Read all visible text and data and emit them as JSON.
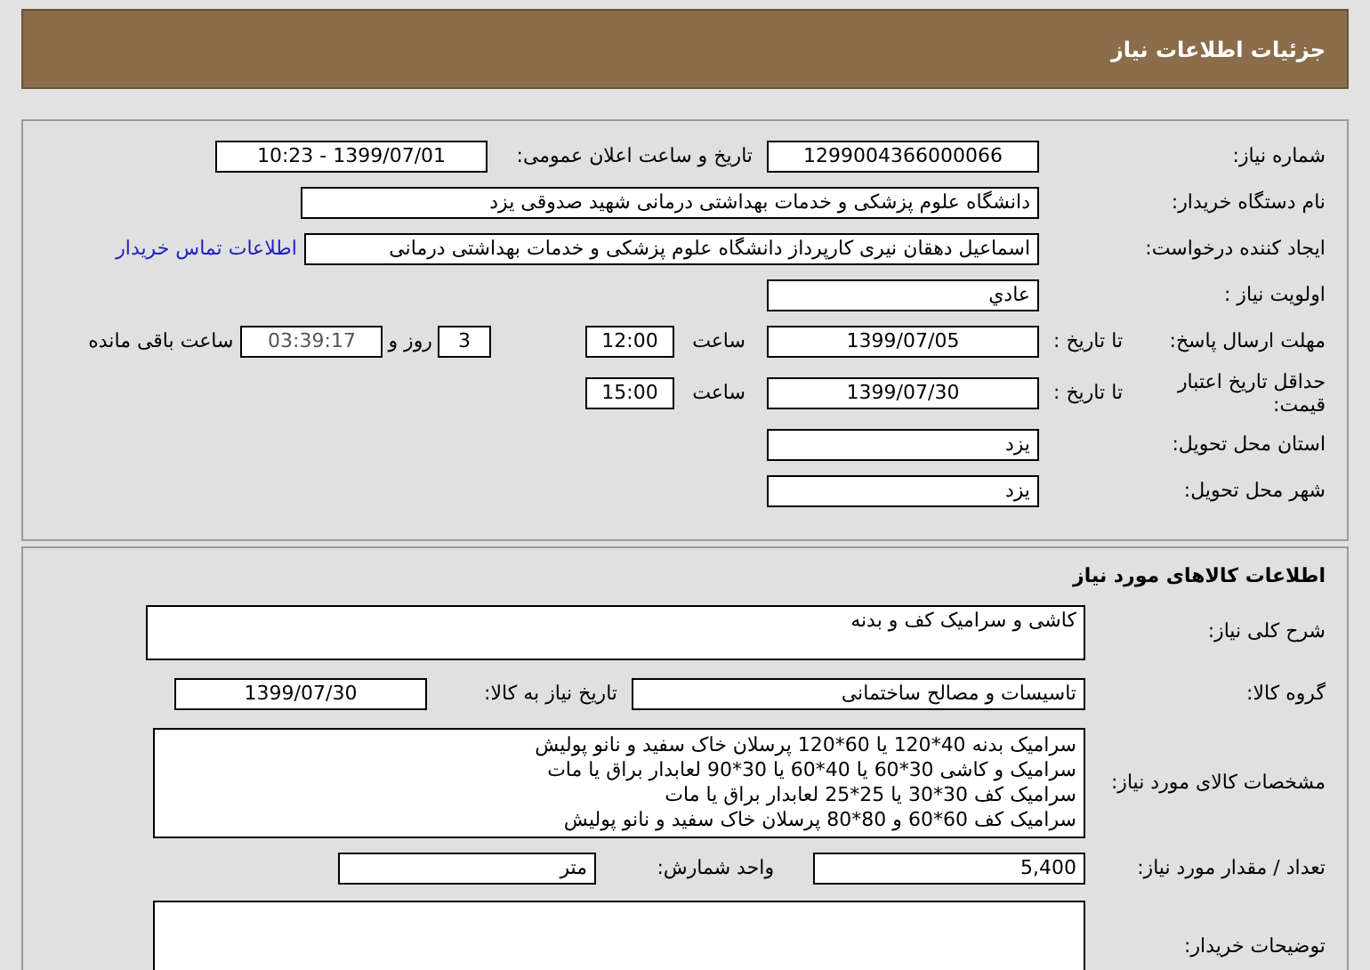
{
  "header": {
    "title": "جزئیات اطلاعات نیاز"
  },
  "details": {
    "need_number": {
      "label": "شماره نیاز:",
      "value": "1299004366000066"
    },
    "announce": {
      "label": "تاریخ و ساعت اعلان عمومی:",
      "value": "1399/07/01 - 10:23"
    },
    "buyer": {
      "label": "نام دستگاه خریدار:",
      "value": "دانشگاه علوم پزشکی و خدمات بهداشتی درمانی شهید صدوقی یزد"
    },
    "requester": {
      "label": "ایجاد کننده درخواست:",
      "value": "اسماعیل دهقان نیری کارپرداز دانشگاه علوم پزشکی و خدمات بهداشتی درمانی",
      "link": "اطلاعات تماس خریدار"
    },
    "priority": {
      "label": "اولویت نیاز :",
      "value": "عادي"
    },
    "deadline": {
      "label": "مهلت ارسال پاسخ:",
      "to_date_label": "تا تاریخ :",
      "date": "1399/07/05",
      "time_label": "ساعت",
      "time": "12:00",
      "days": "3",
      "days_label": "روز و",
      "remaining": "03:39:17",
      "remaining_label": "ساعت باقی مانده"
    },
    "validity": {
      "label": "حداقل تاریخ اعتبار قیمت:",
      "to_date_label": "تا تاریخ :",
      "date": "1399/07/30",
      "time_label": "ساعت",
      "time": "15:00"
    },
    "province": {
      "label": "استان محل تحویل:",
      "value": "یزد"
    },
    "city": {
      "label": "شهر محل تحویل:",
      "value": "یزد"
    }
  },
  "goods": {
    "title": "اطلاعات کالاهای مورد نیاز",
    "description": {
      "label": "شرح کلی نیاز:",
      "value": "کاشی و سرامیک کف و بدنه"
    },
    "group": {
      "label": "گروه کالا:",
      "value": "تاسیسات و مصالح ساختمانی",
      "need_date_label": "تاریخ نیاز به کالا:",
      "need_date": "1399/07/30"
    },
    "specs": {
      "label": "مشخصات کالای مورد نیاز:",
      "lines": [
        "سرامیک بدنه 40*120 یا 60*120 پرسلان خاک سفید و نانو پولیش",
        "سرامیک و کاشی 30*60 یا 40*60 یا 30*90 لعابدار براق یا مات",
        "سرامیک کف 30*30 یا 25*25 لعابدار براق یا مات",
        "سرامیک کف 60*60 و 80*80 پرسلان خاک سفید و نانو پولیش"
      ]
    },
    "quantity": {
      "label": "تعداد / مقدار مورد نیاز:",
      "value": "5,400",
      "unit_label": "واحد شمارش:",
      "unit": "متر"
    },
    "notes": {
      "label": "توضیحات خریدار:"
    }
  }
}
